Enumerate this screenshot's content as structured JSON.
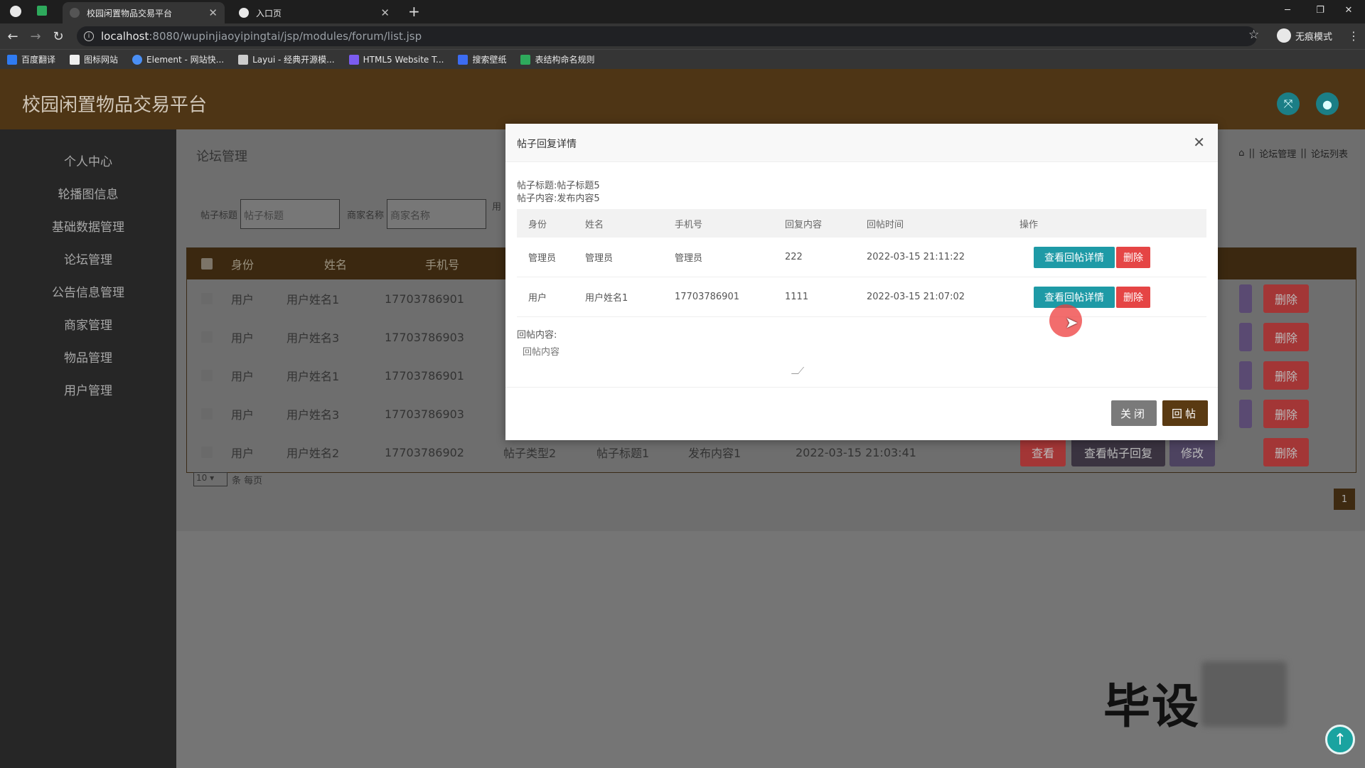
{
  "browser": {
    "tabs": [
      {
        "title": "校园闲置物品交易平台",
        "active": true
      },
      {
        "title": "入口页",
        "active": false
      }
    ],
    "new_tab": "+",
    "url_host": "localhost",
    "url_path": ":8080/wupinjiaoyipingtai/jsp/modules/forum/list.jsp",
    "incognito_label": "无痕模式",
    "bookmarks": [
      "百度翻译",
      "图标网站",
      "Element - 网站快...",
      "Layui - 经典开源模...",
      "HTML5 Website T...",
      "搜索壁纸",
      "表结构命名规则"
    ]
  },
  "app": {
    "title": "校园闲置物品交易平台",
    "sidebar": [
      "个人中心",
      "轮播图信息",
      "基础数据管理",
      "论坛管理",
      "公告信息管理",
      "商家管理",
      "物品管理",
      "用户管理"
    ],
    "page_title": "论坛管理",
    "breadcrumb": [
      "论坛管理",
      "论坛列表"
    ],
    "filters": [
      {
        "label": "帖子标题",
        "placeholder": "帖子标题"
      },
      {
        "label": "商家名称",
        "placeholder": "商家名称"
      },
      {
        "label": "用"
      }
    ],
    "table": {
      "headers": [
        "身份",
        "姓名",
        "手机号"
      ],
      "rows": [
        {
          "role": "用户",
          "name": "用户姓名1",
          "phone": "17703786901"
        },
        {
          "role": "用户",
          "name": "用户姓名3",
          "phone": "17703786903"
        },
        {
          "role": "用户",
          "name": "用户姓名1",
          "phone": "17703786901"
        },
        {
          "role": "用户",
          "name": "用户姓名3",
          "phone": "17703786903"
        },
        {
          "role": "用户",
          "name": "用户姓名2",
          "phone": "17703786902",
          "type": "帖子类型2",
          "post_title": "帖子标题1",
          "content": "发布内容1",
          "time": "2022-03-15 21:03:41"
        }
      ],
      "buttons": {
        "view": "查看",
        "view_replies": "查看帖子回复",
        "edit": "修改",
        "delete": "删除"
      }
    },
    "page_size": "10",
    "page_size_unit": "条 每页",
    "current_page": "1",
    "watermark": "毕设"
  },
  "modal": {
    "title": "帖子回复详情",
    "post_title_line": "帖子标题:帖子标题5",
    "post_content_line": "帖子内容:发布内容5",
    "headers": [
      "身份",
      "姓名",
      "手机号",
      "回复内容",
      "回帖时间",
      "操作"
    ],
    "rows": [
      {
        "role": "管理员",
        "name": "管理员",
        "phone": "管理员",
        "reply": "222",
        "time": "2022-03-15 21:11:22"
      },
      {
        "role": "用户",
        "name": "用户姓名1",
        "phone": "17703786901",
        "reply": "1111",
        "time": "2022-03-15 21:07:02"
      }
    ],
    "view_detail_btn": "查看回帖详情",
    "delete_btn": "删除",
    "reply_label": "回帖内容:",
    "reply_placeholder": "回帖内容",
    "close_btn": "关闭",
    "reply_btn": "回帖"
  },
  "colors": {
    "header_brown": "#4e3515",
    "teal": "#1e9aa6",
    "danger": "#e54545"
  }
}
